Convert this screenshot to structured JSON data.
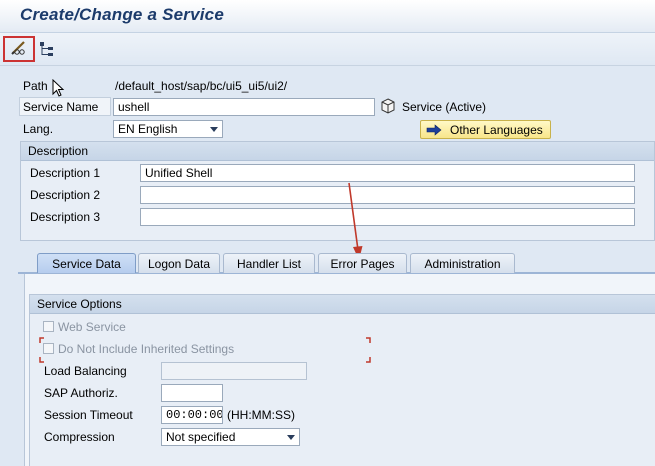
{
  "window": {
    "title": "Create/Change a Service"
  },
  "toolbar": {
    "edit_icon": "pencil-glasses-icon",
    "tree_icon": "hierarchy-icon"
  },
  "form": {
    "path_label": "Path",
    "path_value": "/default_host/sap/bc/ui5_ui5/ui2/",
    "service_name_label": "Service Name",
    "service_name_value": "ushell",
    "service_status": "Service (Active)",
    "lang_label": "Lang.",
    "lang_value": "EN English",
    "other_languages_label": "Other Languages"
  },
  "description": {
    "header": "Description",
    "rows": [
      {
        "label": "Description 1",
        "value": "Unified Shell"
      },
      {
        "label": "Description 2",
        "value": ""
      },
      {
        "label": "Description 3",
        "value": ""
      }
    ]
  },
  "tabs": [
    {
      "label": "Service Data",
      "active": true
    },
    {
      "label": "Logon Data",
      "active": false
    },
    {
      "label": "Handler List",
      "active": false
    },
    {
      "label": "Error Pages",
      "active": false
    },
    {
      "label": "Administration",
      "active": false
    }
  ],
  "service_options": {
    "header": "Service Options",
    "web_service_label": "Web Service",
    "do_not_include_label": "Do Not Include Inherited Settings",
    "load_balancing_label": "Load Balancing",
    "load_balancing_value": "",
    "sap_authoriz_label": "SAP Authoriz.",
    "sap_authoriz_value": "",
    "session_timeout_label": "Session Timeout",
    "session_timeout_value": "00:00:00",
    "session_timeout_format": "(HH:MM:SS)",
    "compression_label": "Compression",
    "compression_value": "Not specified"
  },
  "colors": {
    "annotation_red": "#c0392b",
    "title_blue": "#1c3b6b"
  }
}
